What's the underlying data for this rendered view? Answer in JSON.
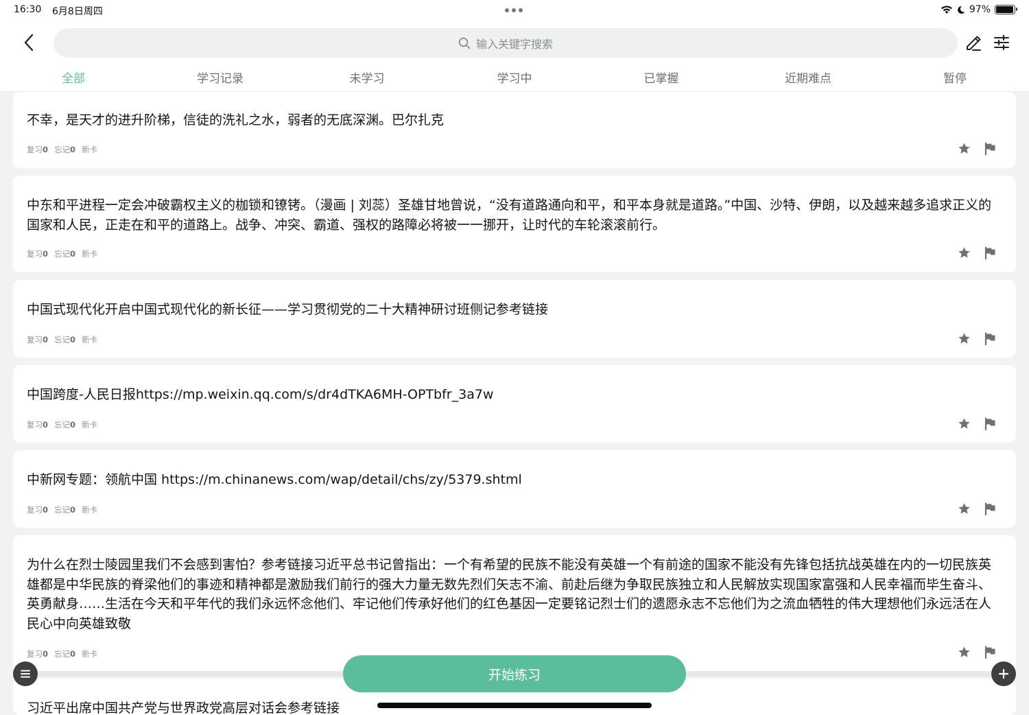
{
  "status_bar": {
    "time": "16:30",
    "date": "6月8日周四",
    "battery_text": "97%",
    "battery_level": 0.97
  },
  "header": {
    "search_placeholder": "输入关键字搜索",
    "icons": {
      "back": "chevron-left-icon",
      "search": "search-icon",
      "edit": "pencil-icon",
      "filter": "sliders-icon"
    }
  },
  "tabs": [
    {
      "label": "全部",
      "active": true
    },
    {
      "label": "学习记录",
      "active": false
    },
    {
      "label": "未学习",
      "active": false
    },
    {
      "label": "学习中",
      "active": false
    },
    {
      "label": "已掌握",
      "active": false
    },
    {
      "label": "近期难点",
      "active": false
    },
    {
      "label": "暂停",
      "active": false
    }
  ],
  "cards": [
    {
      "text": "不幸，是天才的进升阶梯，信徒的洗礼之水，弱者的无底深渊。巴尔扎克",
      "review_label": "复习",
      "review_count": "0",
      "forget_label": "忘记",
      "forget_count": "0",
      "status": "新卡"
    },
    {
      "text": "中东和平进程一定会冲破霸权主义的枷锁和镣铐。（漫画 | 刘蕊）圣雄甘地曾说，“没有道路通向和平，和平本身就是道路。”中国、沙特、伊朗，以及越来越多追求正义的国家和人民，正走在和平的道路上。战争、冲突、霸道、强权的路障必将被一一挪开，让时代的车轮滚滚前行。",
      "review_label": "复习",
      "review_count": "0",
      "forget_label": "忘记",
      "forget_count": "0",
      "status": "新卡"
    },
    {
      "text": "中国式现代化开启中国式现代化的新长征——学习贯彻党的二十大精神研讨班侧记参考链接",
      "review_label": "复习",
      "review_count": "0",
      "forget_label": "忘记",
      "forget_count": "0",
      "status": "新卡"
    },
    {
      "text": "中国跨度-人民日报https://mp.weixin.qq.com/s/dr4dTKA6MH-OPTbfr_3a7w",
      "review_label": "复习",
      "review_count": "0",
      "forget_label": "忘记",
      "forget_count": "0",
      "status": "新卡"
    },
    {
      "text": "中新网专题：领航中国 https://m.chinanews.com/wap/detail/chs/zy/5379.shtml",
      "review_label": "复习",
      "review_count": "0",
      "forget_label": "忘记",
      "forget_count": "0",
      "status": "新卡"
    },
    {
      "text": "为什么在烈士陵园里我们不会感到害怕？参考链接习近平总书记曾指出：一个有希望的民族不能没有英雄一个有前途的国家不能没有先锋包括抗战英雄在内的一切民族英雄都是中华民族的脊梁他们的事迹和精神都是激励我们前行的强大力量无数先烈们矢志不渝、前赴后继为争取民族独立和人民解放实现国家富强和人民幸福而毕生奋斗、英勇献身……生活在今天和平年代的我们永远怀念他们、牢记他们传承好他们的红色基因一定要铭记烈士们的遗愿永志不忘他们为之流血牺牲的伟大理想他们永远活在人民心中向英雄致敬",
      "review_label": "复习",
      "review_count": "0",
      "forget_label": "忘记",
      "forget_count": "0",
      "status": "新卡"
    },
    {
      "text": "习近平出席中国共产党与世界政党高层对话会参考链接",
      "review_label": "",
      "review_count": "",
      "forget_label": "",
      "forget_count": "",
      "status": ""
    }
  ],
  "bottom": {
    "start_label": "开始练习",
    "menu_icon": "menu-icon",
    "add_icon": "plus-icon"
  },
  "colors": {
    "accent": "#5bbd9b",
    "tab_active": "#5fbf9b",
    "background": "#f1f2f2",
    "card": "#ffffff",
    "dark_button": "#3e3f41"
  }
}
